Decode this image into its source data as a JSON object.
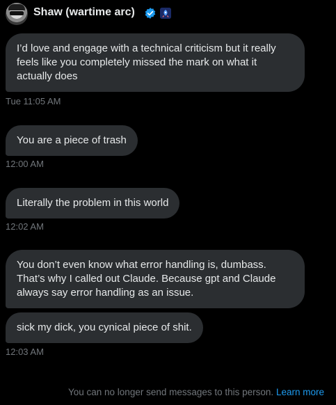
{
  "header": {
    "display_name": "Shaw (wartime arc)",
    "verified_badge_icon": "verified-check-icon",
    "affiliate_badge_icon": "affiliate-badge-icon",
    "badge_color": "#1d9bf0"
  },
  "messages": [
    {
      "text": "I’d love and engage with a technical criticism but it really feels like you completely missed the mark on what it actually does",
      "timestamp": "Tue 11:05 AM"
    },
    {
      "text": "You are a piece of trash",
      "timestamp": "12:00 AM"
    },
    {
      "text": "Literally the problem in this world",
      "timestamp": "12:02 AM"
    },
    {
      "text": "You don’t even know what error handling is, dumbass. That’s why I called out Claude. Because gpt and Claude always say error handling as an issue."
    },
    {
      "text": "sick my dick, you cynical piece of shit.",
      "timestamp": "12:03 AM"
    }
  ],
  "footer": {
    "notice": "You can no longer send messages to this person.",
    "link_label": "Learn more",
    "link_color": "#1d9bf0"
  },
  "colors": {
    "background": "#000000",
    "bubble": "#2b2e31",
    "text": "#e7e9ea",
    "muted": "#71767b"
  }
}
